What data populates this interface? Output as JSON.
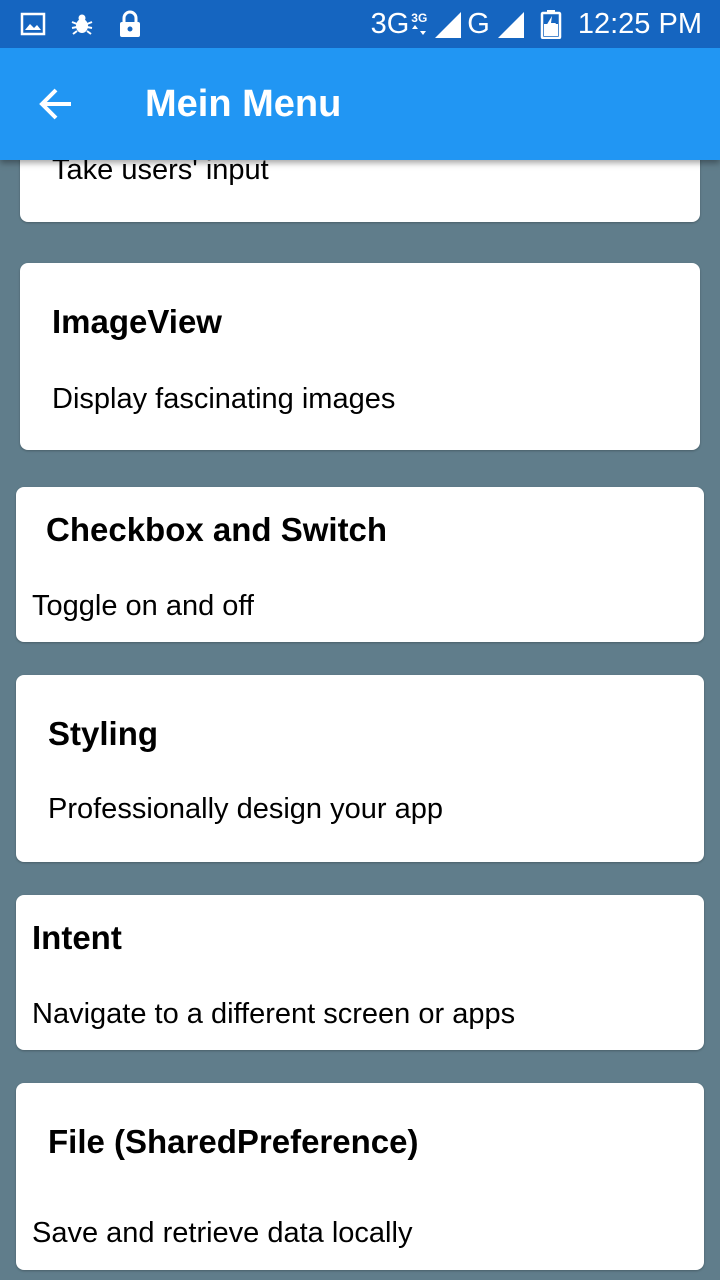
{
  "status_bar": {
    "network_primary": "3G",
    "network_secondary": "3G",
    "network_g": "G",
    "time": "12:25 PM",
    "icons": [
      "image-icon",
      "bug-icon",
      "lock-icon",
      "signal-icon",
      "battery-charging-icon"
    ]
  },
  "app_bar": {
    "title": "Mein Menu",
    "back_icon": "arrow-left-icon"
  },
  "menu": {
    "items": [
      {
        "title": "",
        "description": "Take users' input"
      },
      {
        "title": "ImageView",
        "description": "Display fascinating images"
      },
      {
        "title": "Checkbox and Switch",
        "description": "Toggle on and off"
      },
      {
        "title": "Styling",
        "description": "Professionally design your app"
      },
      {
        "title": "Intent",
        "description": "Navigate to a different screen or apps"
      },
      {
        "title": "File (SharedPreference)",
        "description": "Save and retrieve data locally"
      }
    ]
  },
  "colors": {
    "status_bar": "#1565c0",
    "app_bar": "#2196f3",
    "background": "#607d8b",
    "card": "#ffffff"
  }
}
